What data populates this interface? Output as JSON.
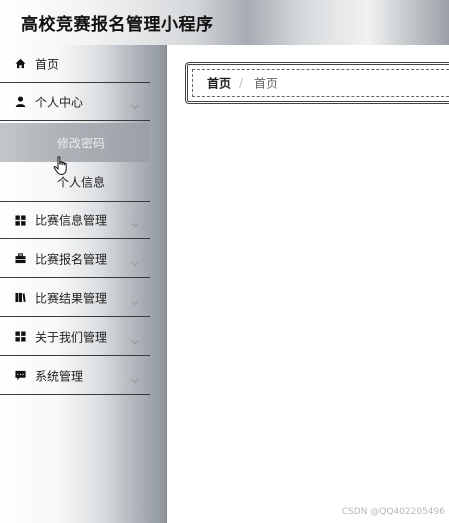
{
  "header": {
    "title": "高校竞赛报名管理小程序"
  },
  "sidebar": {
    "items": [
      {
        "label": "首页",
        "icon": "home-icon"
      },
      {
        "label": "个人中心",
        "icon": "user-icon",
        "expanded": true,
        "children": [
          {
            "label": "修改密码",
            "active": true
          },
          {
            "label": "个人信息"
          }
        ]
      },
      {
        "label": "比赛信息管理",
        "icon": "grid-icon"
      },
      {
        "label": "比赛报名管理",
        "icon": "briefcase-icon"
      },
      {
        "label": "比赛结果管理",
        "icon": "book-icon"
      },
      {
        "label": "关于我们管理",
        "icon": "grid-icon"
      },
      {
        "label": "系统管理",
        "icon": "chat-icon"
      }
    ]
  },
  "breadcrumb": {
    "home": "首页",
    "separator": "/",
    "current": "首页"
  },
  "watermark": "CSDN @QQ402205496"
}
